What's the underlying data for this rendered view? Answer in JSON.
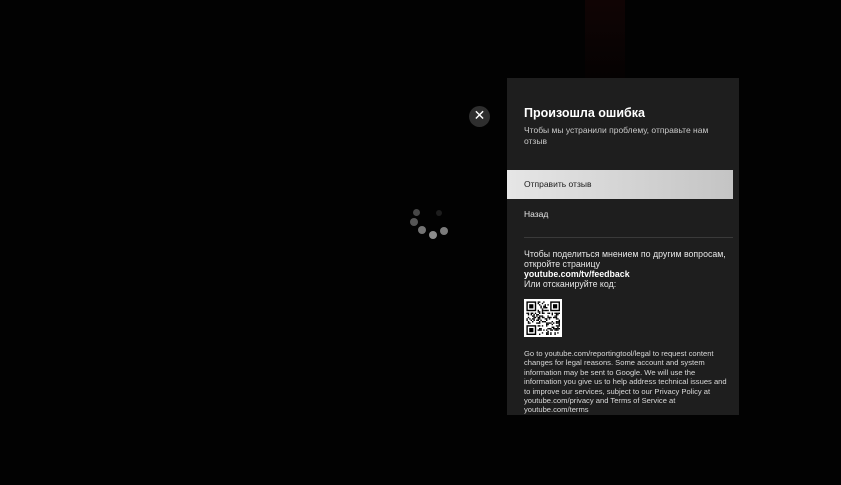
{
  "close_button": {
    "label": "✕"
  },
  "dialog": {
    "title": "Произошла ошибка",
    "subtitle": "Чтобы мы устранили проблему, отправьте нам отзыв",
    "menu": [
      {
        "label": "Отправить отзыв",
        "selected": true
      },
      {
        "label": "Назад",
        "selected": false
      }
    ],
    "feedback_text": "Чтобы поделиться мнением по другим вопросам, откройте страницу",
    "feedback_link": "youtube.com/tv/feedback",
    "scan_text": "Или отсканируйте код:",
    "legal_text": "Go to youtube.com/reportingtool/legal to request content changes for legal reasons. Some account and system information may be sent to Google. We will use the information you give us to help address technical issues and to improve our services, subject to our Privacy Policy at youtube.com/privacy and Terms of Service at youtube.com/terms"
  },
  "colors": {
    "background": "#020202",
    "panel": "#1e1e1e",
    "selected_item": "#d8d8d8",
    "text": "#ffffff"
  },
  "icons": {
    "close": "close-icon",
    "spinner": "loading-spinner-icon",
    "qr": "qr-code-icon"
  }
}
